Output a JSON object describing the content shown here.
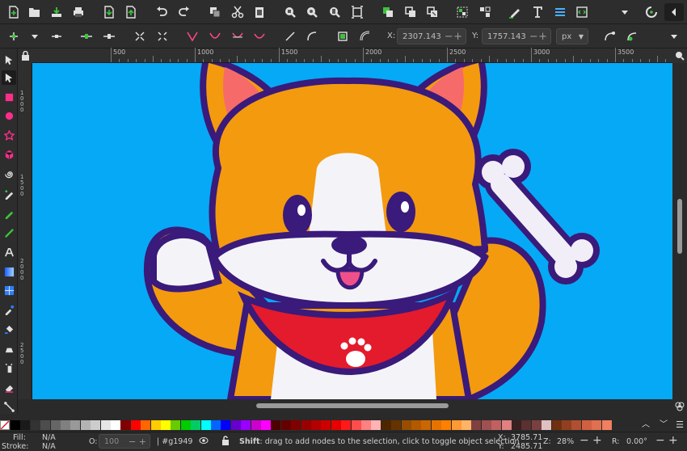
{
  "commands_bar": {
    "icons": [
      "new-document-icon",
      "open-icon",
      "save-icon",
      "print-icon",
      "import-icon",
      "export-icon",
      "undo-icon",
      "redo-icon",
      "copy-icon",
      "cut-icon",
      "paste-icon",
      "zoom-selection-icon",
      "zoom-drawing-icon",
      "zoom-page-icon",
      "zoom-page-width-icon",
      "duplicate-icon",
      "clone-icon",
      "unlink-clone-icon",
      "group-icon",
      "ungroup-icon",
      "fill-stroke-icon",
      "text-font-icon",
      "layers-icon",
      "xml-editor-icon",
      "dropdown-icon",
      "snap-toggle-icon",
      "collapse-icon"
    ]
  },
  "tool_controls": {
    "x_label": "X:",
    "x_value": "2307.143",
    "y_label": "Y:",
    "y_value": "1757.143",
    "unit": "px"
  },
  "ruler": {
    "h_marks": [
      "500",
      "1000",
      "1500",
      "2000",
      "2500",
      "3000",
      "3500"
    ],
    "v_marks": [
      "1000",
      "1500",
      "2000",
      "2500"
    ]
  },
  "palette": {
    "colors": [
      "#000000",
      "#1a1a1a",
      "#333333",
      "#4d4d4d",
      "#666666",
      "#808080",
      "#999999",
      "#b3b3b3",
      "#cccccc",
      "#e6e6e6",
      "#ffffff",
      "#800000",
      "#ff0000",
      "#ff6600",
      "#ffcc00",
      "#ffff00",
      "#66cc00",
      "#00cc00",
      "#00cc66",
      "#00ffff",
      "#0066ff",
      "#0000ff",
      "#6600cc",
      "#9900ff",
      "#cc00cc",
      "#ff00ff",
      "#4d0000",
      "#660000",
      "#800000",
      "#990000",
      "#b30000",
      "#cc0000",
      "#e60000",
      "#ff1a1a",
      "#ff4d4d",
      "#ff8080",
      "#ffb3b3",
      "#4d2600",
      "#663300",
      "#994d00",
      "#b35900",
      "#cc6600",
      "#e67300",
      "#ff8000",
      "#ff9933",
      "#ffb366",
      "#804040",
      "#a05050",
      "#c06060",
      "#e08080",
      "#3a2020",
      "#5a3030",
      "#7a4040",
      "#e0c0c0",
      "#703010",
      "#904020",
      "#b05030",
      "#d06040",
      "#e07050",
      "#f08060"
    ]
  },
  "status": {
    "fill_label": "Fill:",
    "fill_value": "N/A",
    "stroke_label": "Stroke:",
    "stroke_value": "N/A",
    "opacity_label": "O:",
    "opacity_value": "100",
    "layer": "#g1949",
    "message_bold": "Shift",
    "message_rest": ": drag to add nodes to the selection, click to toggle object selection",
    "cursor_x_label": "X:",
    "cursor_x": "3785.71",
    "cursor_y_label": "Y:",
    "cursor_y": "2485.71",
    "zoom_label": "Z:",
    "zoom_value": "28%",
    "rotation_label": "R:",
    "rotation_value": "0.00°"
  }
}
